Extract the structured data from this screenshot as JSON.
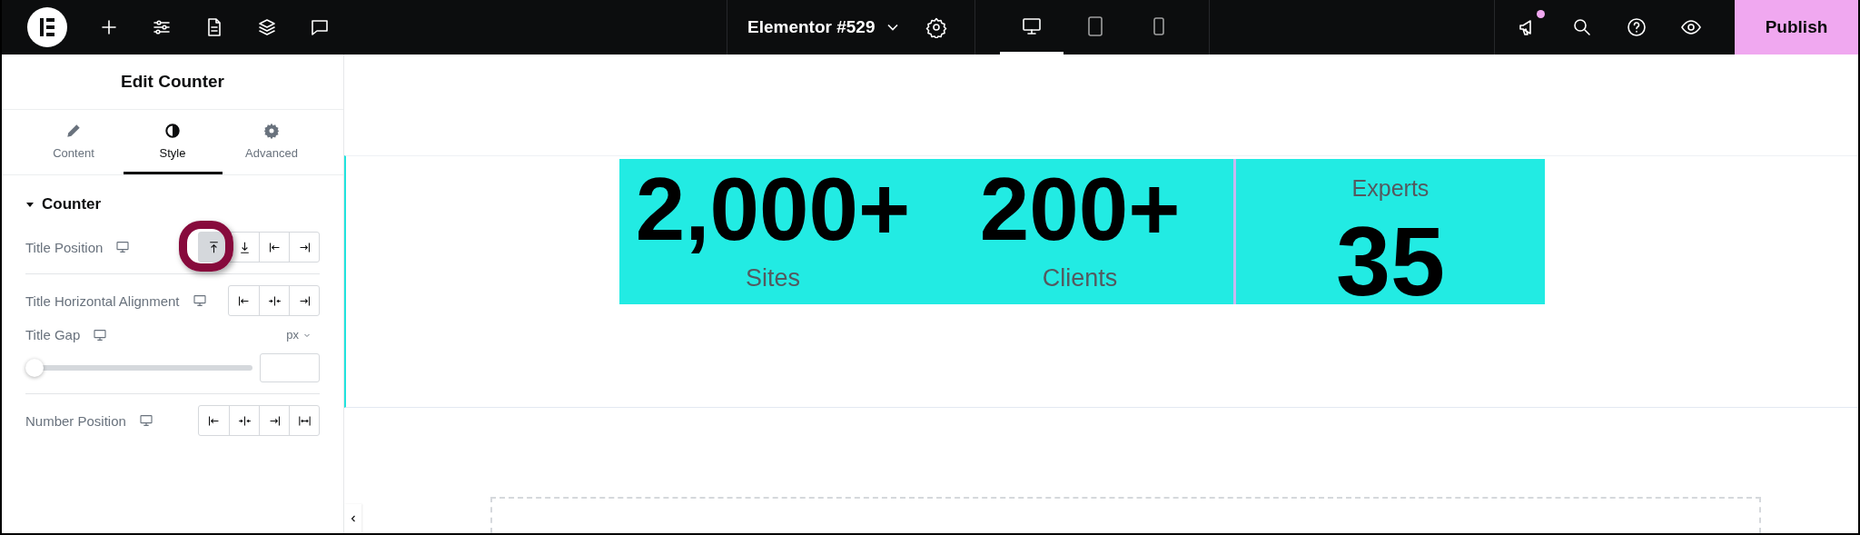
{
  "topbar": {
    "document_title": "Elementor #529",
    "devices": [
      {
        "kind": "desktop",
        "selected": true
      },
      {
        "kind": "tablet",
        "selected": false
      },
      {
        "kind": "mobile",
        "selected": false
      }
    ],
    "notifications": {
      "unread": true
    },
    "publish_button": "Publish"
  },
  "panel": {
    "title": "Edit Counter",
    "tabs": [
      {
        "label": "Content",
        "kind": "content",
        "selected": false
      },
      {
        "label": "Style",
        "kind": "style",
        "selected": true
      },
      {
        "label": "Advanced",
        "kind": "advanced",
        "selected": false
      }
    ],
    "section": {
      "title": "Counter",
      "expanded": true
    },
    "controls": [
      {
        "kind": "choice",
        "label": "Title Position",
        "highlighted": true,
        "options": [
          {
            "kind": "top",
            "selected": true
          },
          {
            "kind": "bottom",
            "selected": false
          },
          {
            "kind": "start",
            "selected": false
          },
          {
            "kind": "end",
            "selected": false
          }
        ]
      },
      {
        "kind": "divider"
      },
      {
        "kind": "choice",
        "label": "Title Horizontal Alignment",
        "highlighted": false,
        "options": [
          {
            "kind": "start",
            "selected": false
          },
          {
            "kind": "center",
            "selected": false
          },
          {
            "kind": "end",
            "selected": false
          }
        ]
      },
      {
        "kind": "slider",
        "label": "Title Gap",
        "unit": "px",
        "level": 0
      },
      {
        "kind": "divider"
      },
      {
        "kind": "choice",
        "label": "Number Position",
        "highlighted": false,
        "options": [
          {
            "kind": "start",
            "selected": false
          },
          {
            "kind": "center",
            "selected": false
          },
          {
            "kind": "end",
            "selected": false
          },
          {
            "kind": "stretch",
            "selected": false
          }
        ]
      }
    ]
  },
  "canvas": {
    "widgets": [
      {
        "counters": [
          {
            "parts": [
              {
                "kind": "number",
                "text": "2,000+"
              },
              {
                "kind": "title",
                "text": "Sites"
              }
            ]
          },
          {
            "parts": [
              {
                "kind": "number",
                "text": "200+"
              },
              {
                "kind": "title",
                "text": "Clients"
              }
            ]
          }
        ]
      },
      {
        "counters": [
          {
            "parts": [
              {
                "kind": "title",
                "text": "Experts"
              },
              {
                "kind": "number",
                "text": "35"
              }
            ]
          }
        ]
      }
    ]
  }
}
